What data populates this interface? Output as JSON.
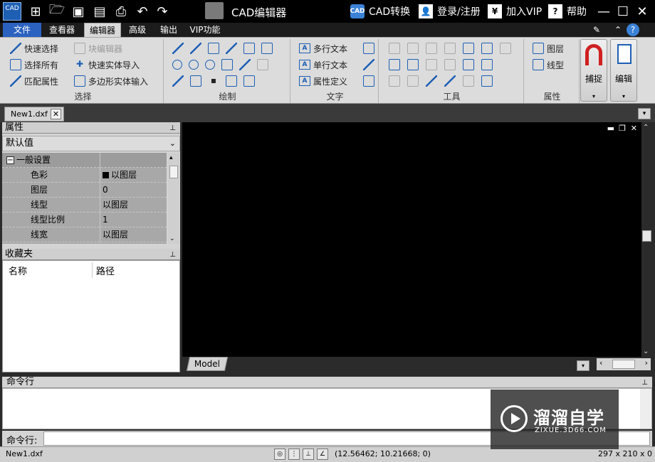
{
  "titlebar": {
    "app_logo": "CAD",
    "title": "CAD编辑器",
    "cad_convert": "CAD转换",
    "cad_convert_icon_text": "CAD",
    "login": "登录/注册",
    "vip": "加入VIP",
    "help": "帮助",
    "help_icon_text": "?",
    "vip_icon_text": "¥"
  },
  "menu": {
    "file": "文件",
    "tabs": [
      "查看器",
      "编辑器",
      "高级",
      "输出",
      "VIP功能"
    ],
    "active": "编辑器"
  },
  "ribbon": {
    "select": {
      "label": "选择",
      "quick_select": "快速选择",
      "block_editor": "块编辑器",
      "select_all": "选择所有",
      "quick_entity_import": "快速实体导入",
      "match_properties": "匹配属性",
      "polygon_entity_input": "多边形实体输入"
    },
    "draw": {
      "label": "绘制"
    },
    "text": {
      "label": "文字",
      "mtext": "多行文本",
      "text": "单行文本",
      "attdef": "属性定义"
    },
    "tools": {
      "label": "工具"
    },
    "properties": {
      "label": "属性",
      "layers": "图层",
      "linetype": "线型"
    },
    "snap": "捕捉",
    "edit": "编辑"
  },
  "doc_tab": {
    "name": "New1.dxf"
  },
  "properties_panel": {
    "title": "属性",
    "selector": "默认值",
    "category": "一般设置",
    "rows": [
      {
        "key": "色彩",
        "value": "以图层"
      },
      {
        "key": "图层",
        "value": "0"
      },
      {
        "key": "线型",
        "value": "以图层"
      },
      {
        "key": "线型比例",
        "value": "1"
      },
      {
        "key": "线宽",
        "value": "以图层"
      }
    ]
  },
  "favorites_panel": {
    "title": "收藏夹",
    "col_name": "名称",
    "col_path": "路径"
  },
  "canvas": {
    "layout_tab": "Model",
    "background": "#000000"
  },
  "command": {
    "title": "命令行",
    "prompt": "命令行:"
  },
  "status": {
    "doc": "New1.dxf",
    "coords": "(12.56462; 10.21668; 0)",
    "paper": "297 x 210 x 0"
  },
  "watermark": {
    "brand": "溜溜自学",
    "url": "ZIXUE.3D66.COM"
  },
  "colors": {
    "accent": "#2b62c0",
    "titlebar": "#000000",
    "ribbon": "#dcdcdc"
  }
}
